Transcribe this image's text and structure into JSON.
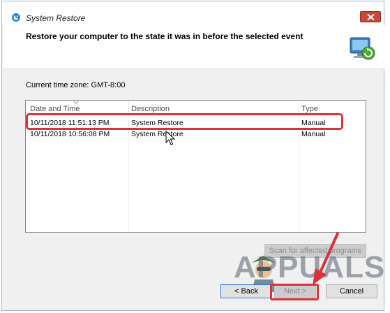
{
  "window": {
    "title": "System Restore",
    "heading": "Restore your computer to the state it was in before the selected event"
  },
  "timezone_label": "Current time zone: GMT-8:00",
  "table": {
    "columns": [
      "Date and Time",
      "Description",
      "Type"
    ],
    "rows": [
      {
        "date": "10/11/2018 11:51:13 PM",
        "description": "System Restore",
        "type": "Manual"
      },
      {
        "date": "10/11/2018 10:56:08 PM",
        "description": "System Restore",
        "type": "Manual"
      }
    ]
  },
  "buttons": {
    "scan": "Scan for affected programs",
    "back": "< Back",
    "next": "Next >",
    "cancel": "Cancel"
  },
  "watermark_text": "APPUALS",
  "colors": {
    "annotation_red": "#d9323a",
    "close_button": "#c8483a",
    "focus_blue": "#2f78d4"
  },
  "icons": [
    "system-restore-icon",
    "close-icon",
    "sort-arrow-icon",
    "mouse-cursor-icon",
    "red-arrow-icon",
    "mascot-icon"
  ]
}
